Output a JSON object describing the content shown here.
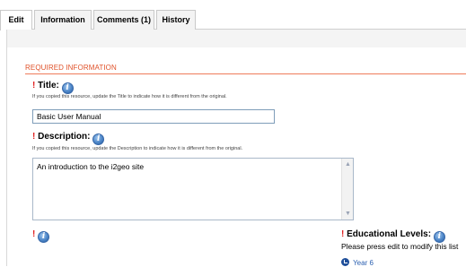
{
  "tabs": [
    {
      "label": "Edit",
      "active": true
    },
    {
      "label": "Information",
      "active": false
    },
    {
      "label": "Comments (1)",
      "active": false
    },
    {
      "label": "History",
      "active": false
    }
  ],
  "section": {
    "title": "REQUIRED INFORMATION",
    "required_marker": "!"
  },
  "fields": {
    "title": {
      "label": "Title:",
      "hint": "If you copied this resource, update the Title to indicate how it is different from the original.",
      "value": "Basic User Manual"
    },
    "description": {
      "label": "Description:",
      "hint": "If you copied this resource, update the Description to indicate how it is different from the original.",
      "value": "An introduction to the i2geo site"
    }
  },
  "educational_levels": {
    "label": "Educational Levels:",
    "note": "Please press edit to modify this list",
    "items": [
      "Year 6"
    ]
  },
  "icons": {
    "info": "info-icon",
    "level_bullet": "level-bullet-icon"
  },
  "colors": {
    "section_title": "#e0522a",
    "required_marker": "#e02020",
    "link": "#2a5fb0"
  }
}
